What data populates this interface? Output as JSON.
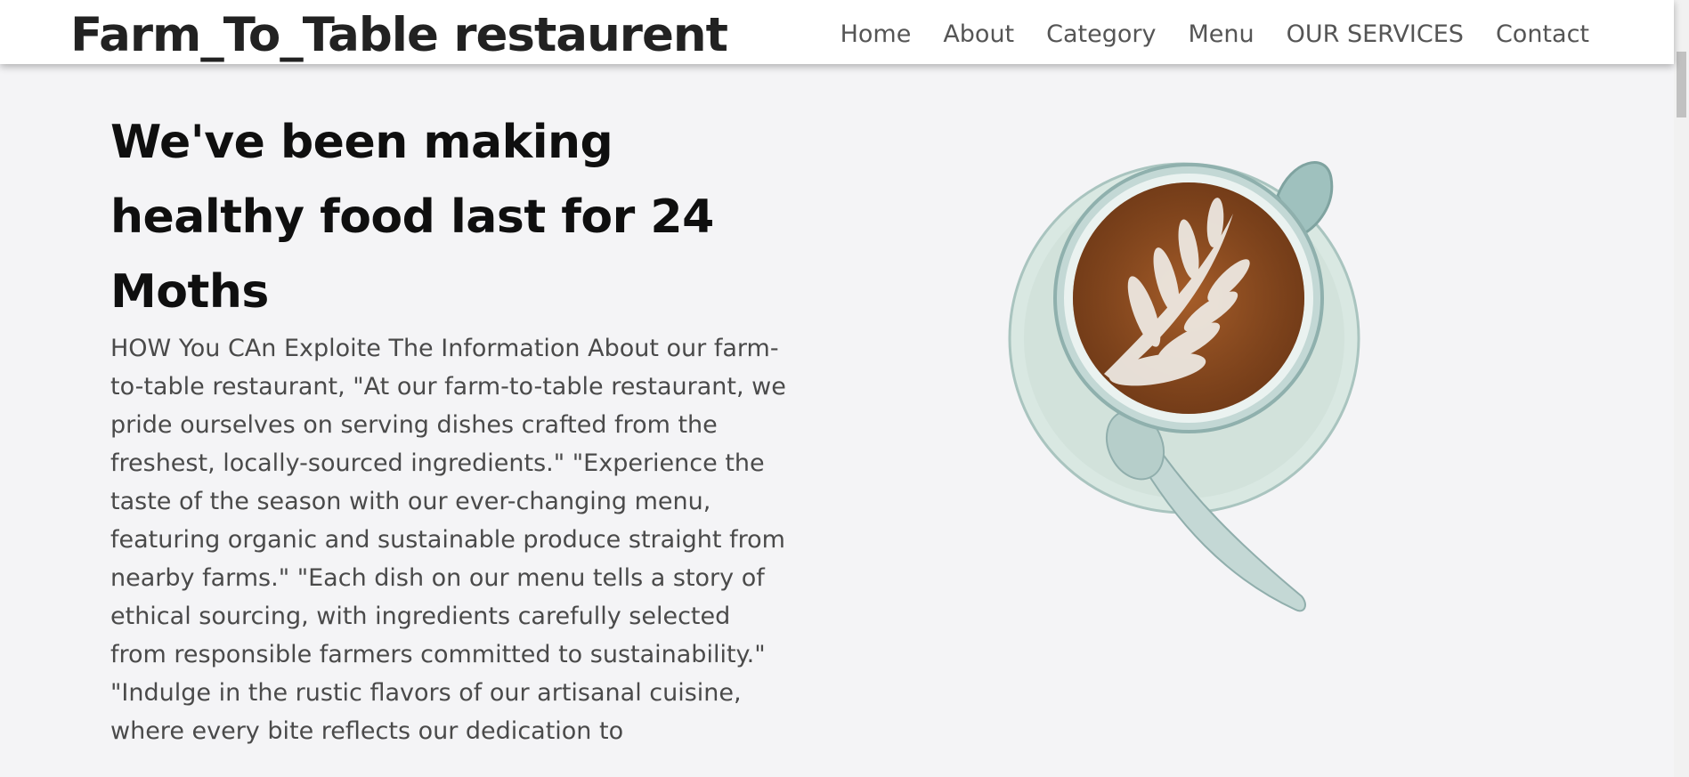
{
  "header": {
    "brand": "Farm_To_Table restaurent",
    "nav": [
      "Home",
      "About",
      "Category",
      "Menu",
      "OUR SERVICES",
      "Contact"
    ]
  },
  "hero": {
    "headline": "We've been making healthy food last for 24 Moths",
    "body": "HOW You CAn Exploite The Information About our farm-to-table restaurant, \"At our farm-to-table restaurant, we pride ourselves on serving dishes crafted from the freshest, locally-sourced ingredients.\" \"Experience the taste of the season with our ever-changing menu, featuring organic and sustainable produce straight from nearby farms.\" \"Each dish on our menu tells a story of ethical sourcing, with ingredients carefully selected from responsible farmers committed to sustainability.\" \"Indulge in the rustic flavors of our artisanal cuisine, where every bite reflects our dedication to"
  },
  "illustration": {
    "icon": "latte-cup-illustration",
    "colors": {
      "saucer": "#cfe0da",
      "cup": "#b9d2cf",
      "coffee": "#8a4a1f",
      "foam": "#f0ece6"
    }
  }
}
